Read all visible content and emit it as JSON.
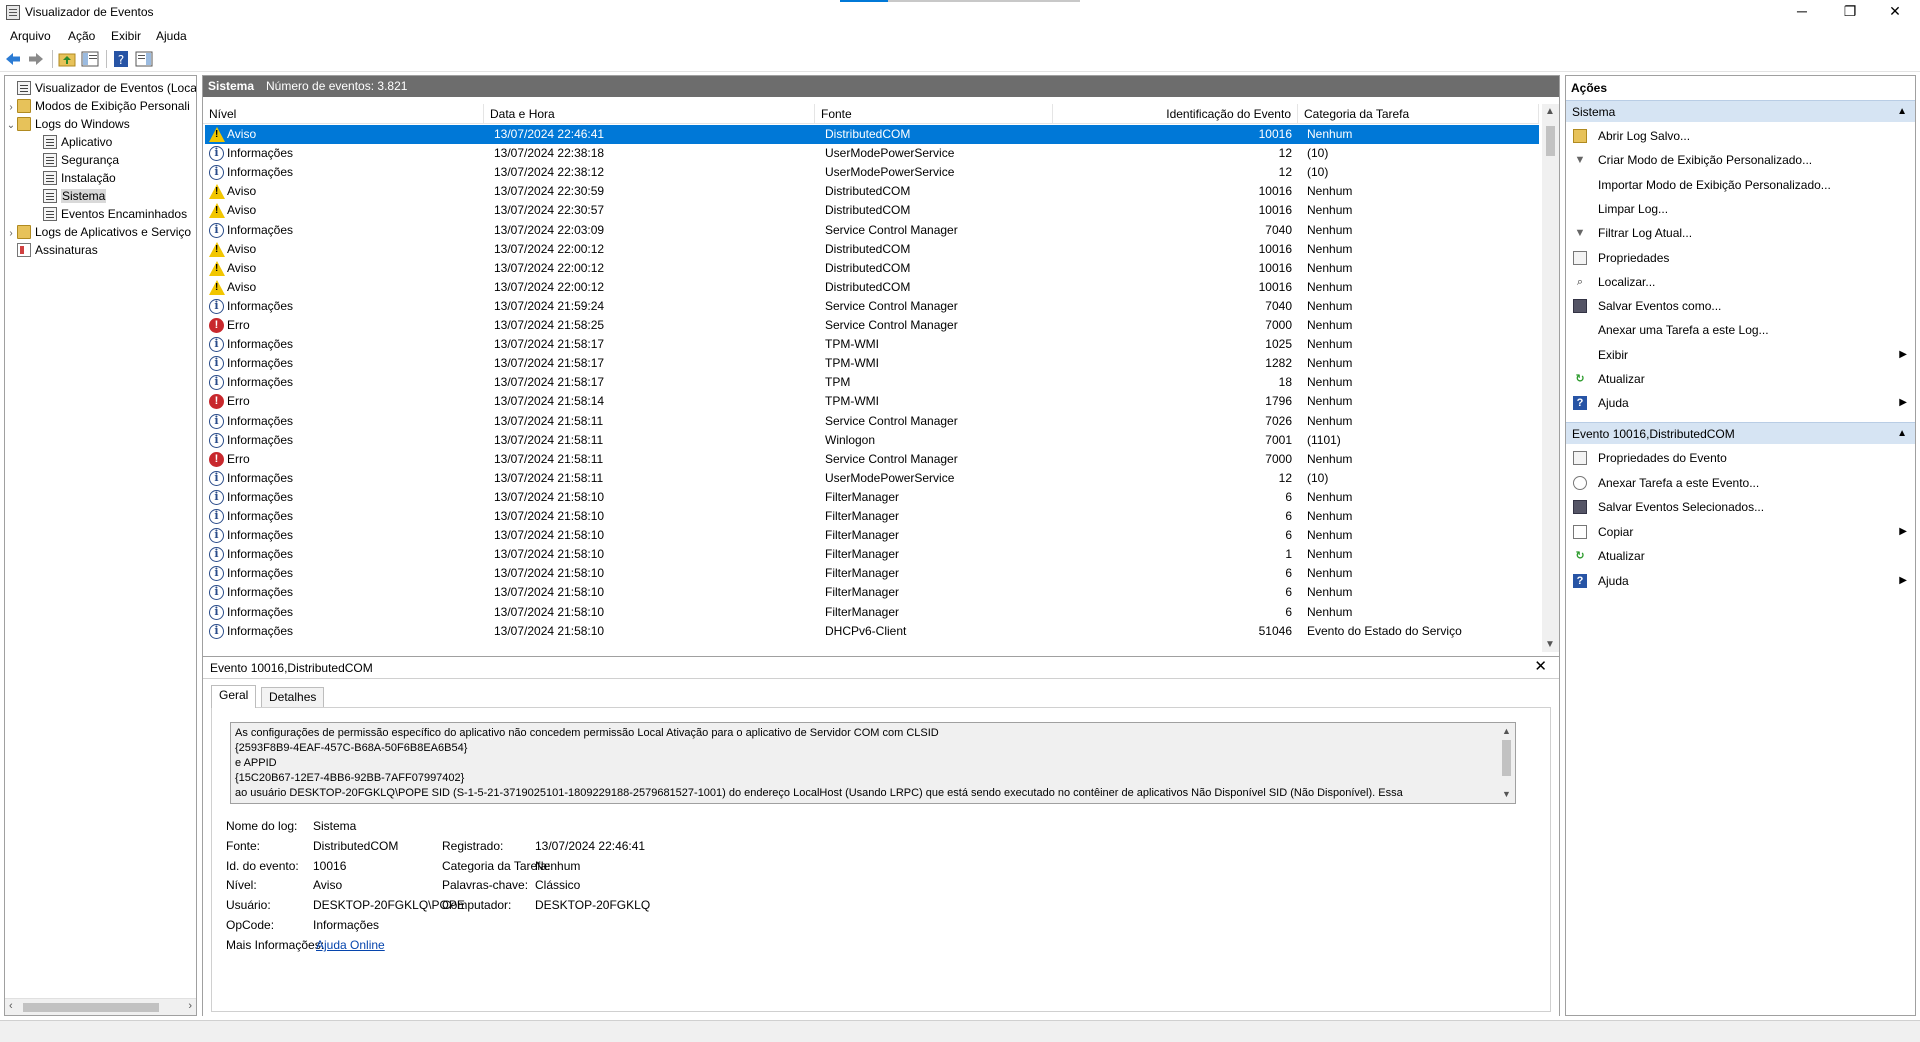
{
  "window": {
    "title": "Visualizador de Eventos",
    "minimize": "─",
    "maximize": "❐",
    "close": "✕"
  },
  "menu": [
    "Arquivo",
    "Ação",
    "Exibir",
    "Ajuda"
  ],
  "tree": {
    "items": [
      {
        "label": "Visualizador de Eventos (Local)",
        "level": 0,
        "expander": "",
        "icon": "log"
      },
      {
        "label": "Modos de Exibição Personali",
        "level": 1,
        "expander": "›",
        "icon": "folder"
      },
      {
        "label": "Logs do Windows",
        "level": 1,
        "expander": "⌄",
        "icon": "folder"
      },
      {
        "label": "Aplicativo",
        "level": 2,
        "expander": "",
        "icon": "log"
      },
      {
        "label": "Segurança",
        "level": 2,
        "expander": "",
        "icon": "log"
      },
      {
        "label": "Instalação",
        "level": 2,
        "expander": "",
        "icon": "log"
      },
      {
        "label": "Sistema",
        "level": 2,
        "expander": "",
        "icon": "log",
        "selected": true
      },
      {
        "label": "Eventos Encaminhados",
        "level": 2,
        "expander": "",
        "icon": "log"
      },
      {
        "label": "Logs de Aplicativos e Serviço",
        "level": 1,
        "expander": "›",
        "icon": "folder"
      },
      {
        "label": "Assinaturas",
        "level": 1,
        "expander": "",
        "icon": "app"
      }
    ]
  },
  "center": {
    "log_name": "Sistema",
    "event_count": "Número de eventos: 3.821"
  },
  "grid": {
    "columns": [
      "Nível",
      "Data e Hora",
      "Fonte",
      "Identificação do Evento",
      "Categoria da Tarefa"
    ],
    "rows": [
      {
        "level": "warn",
        "level_text": "Aviso",
        "datetime": "13/07/2024 22:46:41",
        "source": "DistributedCOM",
        "id": "10016",
        "category": "Nenhum",
        "selected": true
      },
      {
        "level": "info",
        "level_text": "Informações",
        "datetime": "13/07/2024 22:38:18",
        "source": "UserModePowerService",
        "id": "12",
        "category": "(10)"
      },
      {
        "level": "info",
        "level_text": "Informações",
        "datetime": "13/07/2024 22:38:12",
        "source": "UserModePowerService",
        "id": "12",
        "category": "(10)"
      },
      {
        "level": "warn",
        "level_text": "Aviso",
        "datetime": "13/07/2024 22:30:59",
        "source": "DistributedCOM",
        "id": "10016",
        "category": "Nenhum"
      },
      {
        "level": "warn",
        "level_text": "Aviso",
        "datetime": "13/07/2024 22:30:57",
        "source": "DistributedCOM",
        "id": "10016",
        "category": "Nenhum"
      },
      {
        "level": "info",
        "level_text": "Informações",
        "datetime": "13/07/2024 22:03:09",
        "source": "Service Control Manager",
        "id": "7040",
        "category": "Nenhum"
      },
      {
        "level": "warn",
        "level_text": "Aviso",
        "datetime": "13/07/2024 22:00:12",
        "source": "DistributedCOM",
        "id": "10016",
        "category": "Nenhum"
      },
      {
        "level": "warn",
        "level_text": "Aviso",
        "datetime": "13/07/2024 22:00:12",
        "source": "DistributedCOM",
        "id": "10016",
        "category": "Nenhum"
      },
      {
        "level": "warn",
        "level_text": "Aviso",
        "datetime": "13/07/2024 22:00:12",
        "source": "DistributedCOM",
        "id": "10016",
        "category": "Nenhum"
      },
      {
        "level": "info",
        "level_text": "Informações",
        "datetime": "13/07/2024 21:59:24",
        "source": "Service Control Manager",
        "id": "7040",
        "category": "Nenhum"
      },
      {
        "level": "err",
        "level_text": "Erro",
        "datetime": "13/07/2024 21:58:25",
        "source": "Service Control Manager",
        "id": "7000",
        "category": "Nenhum"
      },
      {
        "level": "info",
        "level_text": "Informações",
        "datetime": "13/07/2024 21:58:17",
        "source": "TPM-WMI",
        "id": "1025",
        "category": "Nenhum"
      },
      {
        "level": "info",
        "level_text": "Informações",
        "datetime": "13/07/2024 21:58:17",
        "source": "TPM-WMI",
        "id": "1282",
        "category": "Nenhum"
      },
      {
        "level": "info",
        "level_text": "Informações",
        "datetime": "13/07/2024 21:58:17",
        "source": "TPM",
        "id": "18",
        "category": "Nenhum"
      },
      {
        "level": "err",
        "level_text": "Erro",
        "datetime": "13/07/2024 21:58:14",
        "source": "TPM-WMI",
        "id": "1796",
        "category": "Nenhum"
      },
      {
        "level": "info",
        "level_text": "Informações",
        "datetime": "13/07/2024 21:58:11",
        "source": "Service Control Manager",
        "id": "7026",
        "category": "Nenhum"
      },
      {
        "level": "info",
        "level_text": "Informações",
        "datetime": "13/07/2024 21:58:11",
        "source": "Winlogon",
        "id": "7001",
        "category": "(1101)"
      },
      {
        "level": "err",
        "level_text": "Erro",
        "datetime": "13/07/2024 21:58:11",
        "source": "Service Control Manager",
        "id": "7000",
        "category": "Nenhum"
      },
      {
        "level": "info",
        "level_text": "Informações",
        "datetime": "13/07/2024 21:58:11",
        "source": "UserModePowerService",
        "id": "12",
        "category": "(10)"
      },
      {
        "level": "info",
        "level_text": "Informações",
        "datetime": "13/07/2024 21:58:10",
        "source": "FilterManager",
        "id": "6",
        "category": "Nenhum"
      },
      {
        "level": "info",
        "level_text": "Informações",
        "datetime": "13/07/2024 21:58:10",
        "source": "FilterManager",
        "id": "6",
        "category": "Nenhum"
      },
      {
        "level": "info",
        "level_text": "Informações",
        "datetime": "13/07/2024 21:58:10",
        "source": "FilterManager",
        "id": "6",
        "category": "Nenhum"
      },
      {
        "level": "info",
        "level_text": "Informações",
        "datetime": "13/07/2024 21:58:10",
        "source": "FilterManager",
        "id": "1",
        "category": "Nenhum"
      },
      {
        "level": "info",
        "level_text": "Informações",
        "datetime": "13/07/2024 21:58:10",
        "source": "FilterManager",
        "id": "6",
        "category": "Nenhum"
      },
      {
        "level": "info",
        "level_text": "Informações",
        "datetime": "13/07/2024 21:58:10",
        "source": "FilterManager",
        "id": "6",
        "category": "Nenhum"
      },
      {
        "level": "info",
        "level_text": "Informações",
        "datetime": "13/07/2024 21:58:10",
        "source": "FilterManager",
        "id": "6",
        "category": "Nenhum"
      },
      {
        "level": "info",
        "level_text": "Informações",
        "datetime": "13/07/2024 21:58:10",
        "source": "DHCPv6-Client",
        "id": "51046",
        "category": "Evento do Estado do Serviço"
      }
    ]
  },
  "detail": {
    "title": "Evento 10016,DistributedCOM",
    "close": "✕",
    "tabs": [
      "Geral",
      "Detalhes"
    ],
    "description_lines": [
      "As configurações de permissão específico do aplicativo não concedem permissão Local Ativação para o aplicativo de Servidor COM com CLSID",
      "{2593F8B9-4EAF-457C-B68A-50F6B8EA6B54}",
      " e APPID",
      "{15C20B67-12E7-4BB6-92BB-7AFF07997402}",
      " ao usuário DESKTOP-20FGKLQ\\POPE SID (S-1-5-21-3719025101-1809229188-2579681527-1001) do endereço LocalHost (Usando LRPC) que está sendo executado no contêiner de aplicativos Não Disponível SID (Não Disponível). Essa"
    ],
    "fields": {
      "log_name_label": "Nome do log:",
      "log_name": "Sistema",
      "source_label": "Fonte:",
      "source": "DistributedCOM",
      "logged_label": "Registrado:",
      "logged": "13/07/2024 22:46:41",
      "event_id_label": "Id. do evento:",
      "event_id": "10016",
      "task_label": "Categoria da Tarefa:",
      "task": "Nenhum",
      "level_label": "Nível:",
      "level": "Aviso",
      "keywords_label": "Palavras-chave:",
      "keywords": "Clássico",
      "user_label": "Usuário:",
      "user": "DESKTOP-20FGKLQ\\POPE",
      "computer_label": "Computador:",
      "computer": "DESKTOP-20FGKLQ",
      "opcode_label": "OpCode:",
      "opcode": "Informações",
      "more_label": "Mais Informações:",
      "more_link": "Ajuda Online"
    }
  },
  "actions": {
    "title": "Ações",
    "section1": "Sistema",
    "items1": [
      {
        "label": "Abrir Log Salvo...",
        "icon": "open-folder-icon",
        "cls": "ai-open",
        "glyph": ""
      },
      {
        "label": "Criar Modo de Exibição Personalizado...",
        "icon": "filter-icon",
        "cls": "ai-filter",
        "glyph": "▼"
      },
      {
        "label": "Importar Modo de Exibição Personalizado...",
        "icon": "",
        "cls": "",
        "glyph": ""
      },
      {
        "label": "Limpar Log...",
        "icon": "",
        "cls": "",
        "glyph": ""
      },
      {
        "label": "Filtrar Log Atual...",
        "icon": "filter-icon",
        "cls": "ai-filter",
        "glyph": "▼"
      },
      {
        "label": "Propriedades",
        "icon": "properties-icon",
        "cls": "ai-props",
        "glyph": ""
      },
      {
        "label": "Localizar...",
        "icon": "binoculars-icon",
        "cls": "ai-find",
        "glyph": "⌕"
      },
      {
        "label": "Salvar Eventos como...",
        "icon": "save-icon",
        "cls": "ai-save",
        "glyph": ""
      },
      {
        "label": "Anexar uma Tarefa a este Log...",
        "icon": "",
        "cls": "",
        "glyph": ""
      },
      {
        "label": "Exibir",
        "icon": "",
        "cls": "",
        "glyph": "",
        "submenu": "▶"
      },
      {
        "label": "Atualizar",
        "icon": "refresh-icon",
        "cls": "ai-refresh",
        "glyph": "↻"
      },
      {
        "label": "Ajuda",
        "icon": "help-icon",
        "cls": "ai-help",
        "glyph": "?",
        "submenu": "▶"
      }
    ],
    "section2": "Evento 10016,DistributedCOM",
    "items2": [
      {
        "label": "Propriedades do Evento",
        "icon": "event-properties-icon",
        "cls": "ai-props",
        "glyph": ""
      },
      {
        "label": "Anexar Tarefa a este Evento...",
        "icon": "attach-task-icon",
        "cls": "ai-attach",
        "glyph": ""
      },
      {
        "label": "Salvar Eventos Selecionados...",
        "icon": "save-icon",
        "cls": "ai-save",
        "glyph": ""
      },
      {
        "label": "Copiar",
        "icon": "copy-icon",
        "cls": "ai-copy",
        "glyph": "",
        "submenu": "▶"
      },
      {
        "label": "Atualizar",
        "icon": "refresh-icon",
        "cls": "ai-refresh",
        "glyph": "↻"
      },
      {
        "label": "Ajuda",
        "icon": "help-icon",
        "cls": "ai-help",
        "glyph": "?",
        "submenu": "▶"
      }
    ]
  },
  "toolbar": {
    "back": "🡄",
    "forward": "🡆"
  },
  "colors": {
    "selection": "#0078d7",
    "header_gray": "#6d6d6d",
    "section_blue": "#d6e4f3"
  }
}
